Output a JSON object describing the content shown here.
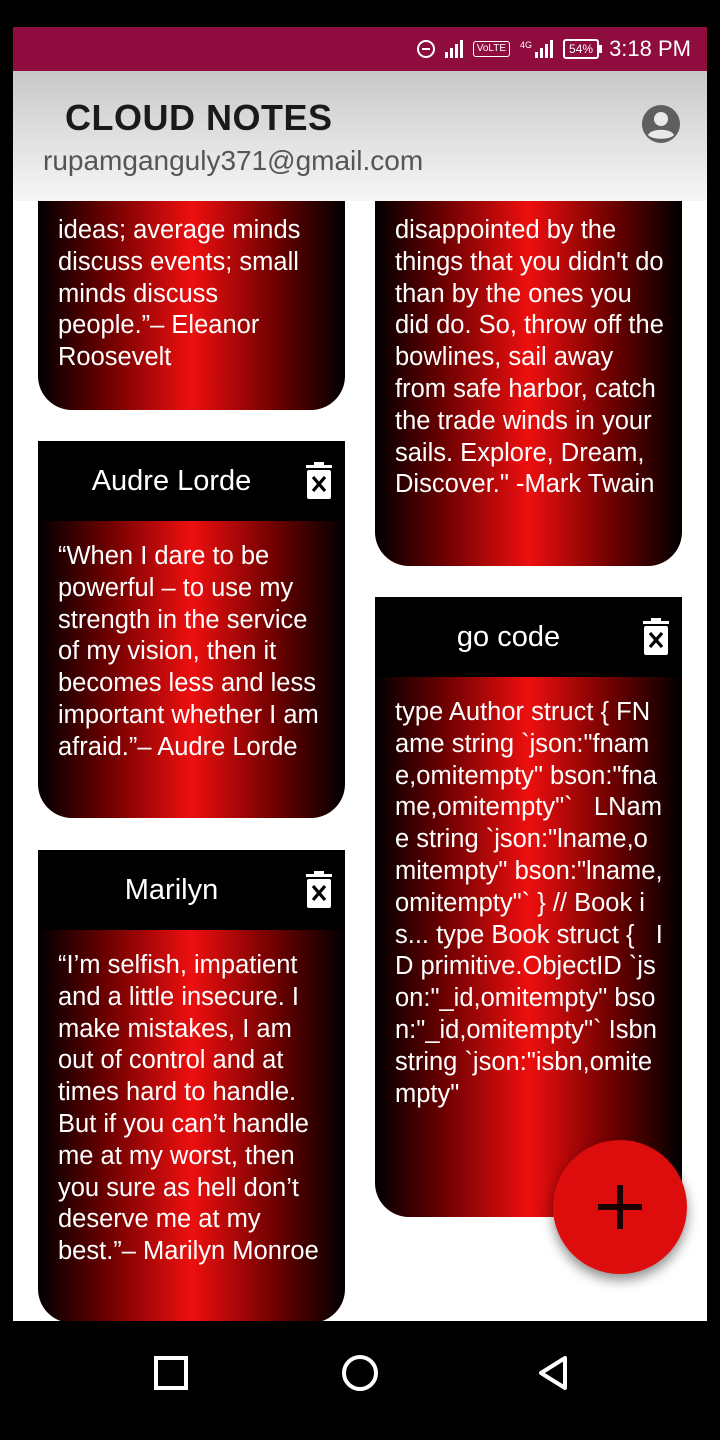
{
  "status_bar": {
    "time": "3:18 PM",
    "battery": "54%",
    "volte": "VoLTE",
    "network": "4G",
    "bg_color": "#8e0c3e"
  },
  "header": {
    "title": "CLOUD NOTES",
    "email": "rupamganguly371@gmail.com",
    "account_icon": "account-circle-icon"
  },
  "notes": [
    {
      "title": "",
      "body": "ideas; average minds discuss events; small minds discuss people.”– Eleanor Roosevelt"
    },
    {
      "title": "Audre Lorde",
      "body": "“When I dare to be powerful – to use my strength in the service of my vision, then it becomes less and less important whether I am afraid.”– Audre Lorde"
    },
    {
      "title": "Marilyn",
      "body": "“I’m selfish, impatient and a little insecure. I make mistakes, I am out of control and at times hard to handle. But if you can’t handle me at my worst, then you sure as hell don’t deserve me at my best.”– Marilyn Monroe"
    },
    {
      "title": "",
      "body": "disappointed by the things that you didn't do than by the ones you did do. So, throw off the bowlines, sail away from safe harbor, catch the trade winds in your sails. Explore, Dream, Discover.\" -Mark Twain"
    },
    {
      "title": "go code",
      "body": "type Author struct { FName string `json:\"fname,omitempty\" bson:\"fname,omitempty\"`   LName string `json:\"lname,omitempty\" bson:\"lname,omitempty\"` } // Book is... type Book struct {   ID primitive.ObjectID `json:\"_id,omitempty\" bson:\"_id,omitempty\"` Isbn string `json:\"isbn,omitempty\""
    }
  ],
  "fab": {
    "icon": "plus-icon",
    "color": "#dd0d0d"
  },
  "nav": [
    "recents-square-icon",
    "home-circle-icon",
    "back-triangle-icon"
  ]
}
